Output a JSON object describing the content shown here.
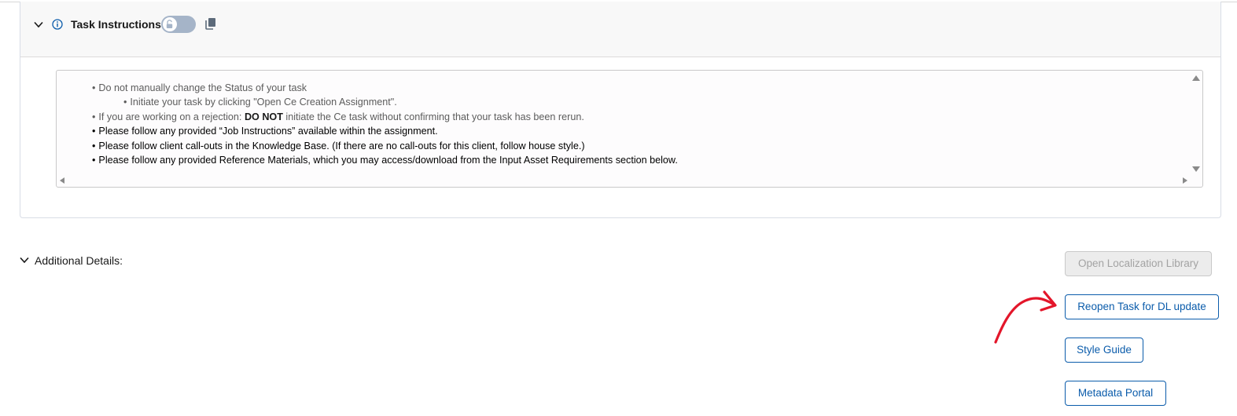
{
  "task_instructions": {
    "title": "Task Instructions",
    "toggle_state": "unlocked",
    "items": [
      {
        "style": "gray",
        "indent": false,
        "text": "Do not manually change the Status of your task"
      },
      {
        "style": "gray",
        "indent": true,
        "text": "Initiate your task by clicking \"Open Ce Creation Assignment\"."
      },
      {
        "style": "gray",
        "indent": false,
        "text_before": "If you are working on a rejection: ",
        "bold": "DO NOT",
        "text_after": " initiate the Ce task without confirming that your task has been rerun."
      },
      {
        "style": "black",
        "indent": false,
        "text": "Please follow any provided “Job Instructions” available within the assignment."
      },
      {
        "style": "black",
        "indent": false,
        "text": "Please follow client call-outs in the Knowledge Base. (If there are no call-outs for this client, follow house style.)"
      },
      {
        "style": "black",
        "indent": false,
        "text": "Please follow any provided Reference Materials, which you may access/download from the Input Asset Requirements section below."
      }
    ]
  },
  "additional_details": {
    "label": "Additional Details:"
  },
  "buttons": {
    "open_localization_library": "Open Localization Library",
    "reopen_task": "Reopen Task for DL update",
    "style_guide": "Style Guide",
    "metadata_portal": "Metadata Portal"
  },
  "colors": {
    "link_blue": "#0b5cab",
    "annotation_red": "#e3162a",
    "toggle_off": "#a5b4c8"
  },
  "icons": [
    "chevron-down-icon",
    "info-icon",
    "lock-open-icon",
    "copy-icon",
    "arrow-annotation"
  ]
}
